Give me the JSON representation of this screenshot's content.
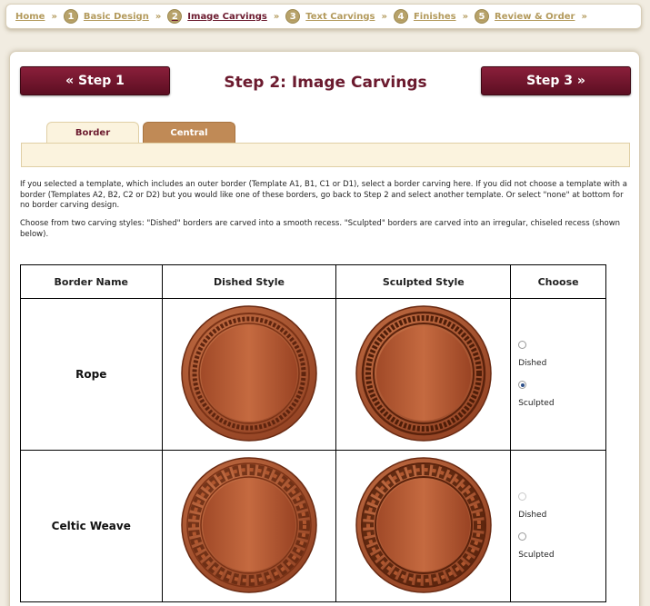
{
  "breadcrumb": [
    {
      "num": "",
      "label": "Home",
      "active": false
    },
    {
      "num": "1",
      "label": "Basic Design",
      "active": false
    },
    {
      "num": "2",
      "label": "Image Carvings",
      "active": true
    },
    {
      "num": "3",
      "label": "Text Carvings",
      "active": false
    },
    {
      "num": "4",
      "label": "Finishes",
      "active": false
    },
    {
      "num": "5",
      "label": "Review & Order",
      "active": false
    }
  ],
  "separator": "»",
  "nav": {
    "prev_label": "«  Step 1",
    "next_label": "Step 3  »"
  },
  "page_title": "Step 2: Image Carvings",
  "tabs": [
    {
      "label": "Border",
      "active": true
    },
    {
      "label": "Central",
      "active": false
    }
  ],
  "intro": {
    "p1": "If you selected a template, which includes an outer border (Template A1, B1, C1 or D1), select a border carving here. If you did not choose a template with a border (Templates A2, B2, C2 or D2) but you would like one of these borders, go back to Step 2 and select another template. Or select \"none\" at bottom for no border carving design.",
    "p2": "Choose from two carving styles: \"Dished\" borders are carved into a smooth recess. \"Sculpted\" borders are carved into an irregular, chiseled recess (shown below)."
  },
  "table": {
    "headers": [
      "Border Name",
      "Dished Style",
      "Sculpted Style",
      "Choose"
    ],
    "rows": [
      {
        "name": "Rope",
        "pattern": "rope",
        "options": [
          "Dished",
          "Sculpted"
        ],
        "selected": "Sculpted"
      },
      {
        "name": "Celtic Weave",
        "pattern": "weave",
        "options": [
          "Dished",
          "Sculpted"
        ],
        "selected": ""
      }
    ]
  },
  "colors": {
    "accent": "#6b1a2e",
    "wood": "#b55a33",
    "gold": "#b7a26a"
  }
}
